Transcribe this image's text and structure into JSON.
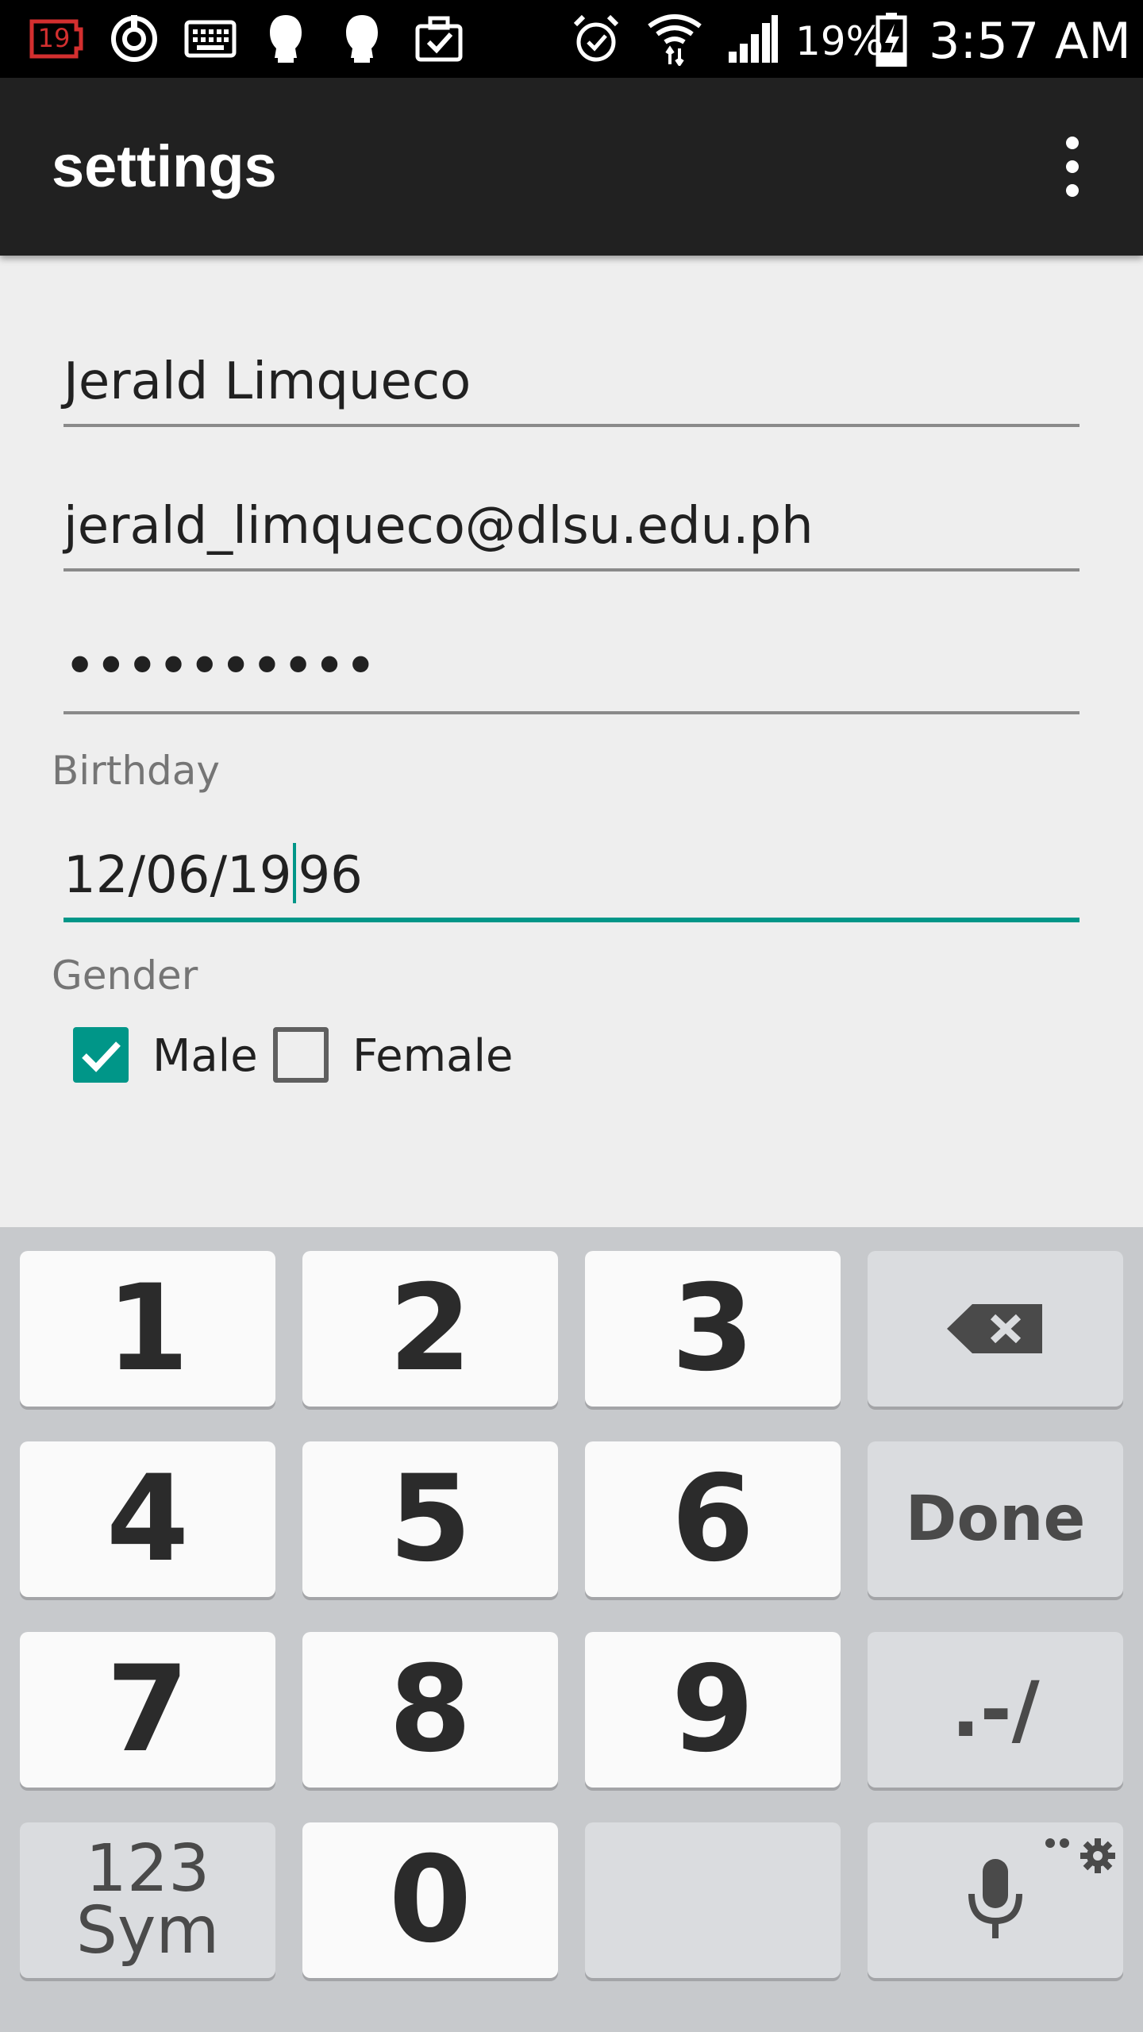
{
  "status_bar": {
    "notification_count": "19",
    "battery": "19%",
    "time": "3:57 AM"
  },
  "action_bar": {
    "title": "settings"
  },
  "form": {
    "name_value": "Jerald Limqueco",
    "email_value": "jerald_limqueco@dlsu.edu.ph",
    "password_value": "••••••••••",
    "birthday_label": "Birthday",
    "birthday_before_cursor": "12/06/19",
    "birthday_after_cursor": "96",
    "gender_label": "Gender",
    "gender_male": "Male",
    "gender_female": "Female"
  },
  "keyboard": {
    "digits": [
      "1",
      "2",
      "3",
      "4",
      "5",
      "6",
      "7",
      "8",
      "9",
      "0"
    ],
    "done": "Done",
    "punct": ".-/",
    "sym_line1": "123",
    "sym_line2": "Sym"
  },
  "colors": {
    "accent": "#009688",
    "action_bar": "#212121",
    "background": "#eeeeee"
  }
}
